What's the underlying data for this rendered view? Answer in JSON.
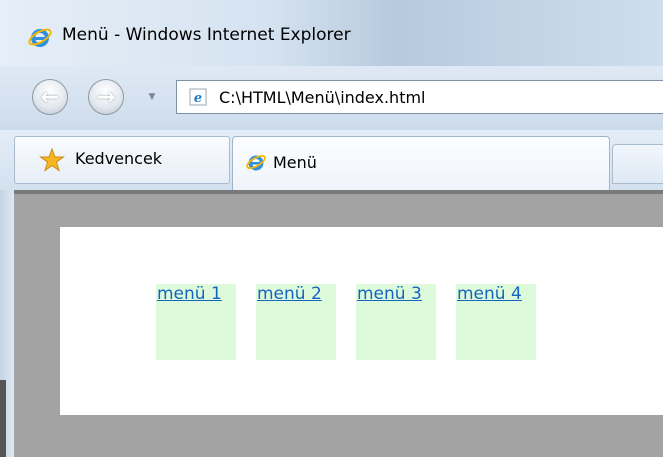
{
  "window": {
    "title": "Menü - Windows Internet Explorer"
  },
  "navigation": {
    "address": "C:\\HTML\\Menü\\index.html"
  },
  "favorites": {
    "label": "Kedvencek"
  },
  "tab": {
    "label": "Menü"
  },
  "page": {
    "menu_items": [
      {
        "label": "menü 1"
      },
      {
        "label": "menü 2"
      },
      {
        "label": "menü 3"
      },
      {
        "label": "menü 4"
      }
    ],
    "colors": {
      "menu_item_background": "#ddfadb",
      "link": "#1565c0",
      "page_background": "#ffffff",
      "viewport_background": "#a3a3a3"
    }
  },
  "icons": {
    "title_icon": "internet-explorer-icon",
    "back": "back-arrow-icon",
    "forward": "forward-arrow-icon",
    "favorites": "star-icon",
    "tab_icon": "internet-explorer-icon",
    "address_icon": "internet-explorer-page-icon"
  }
}
